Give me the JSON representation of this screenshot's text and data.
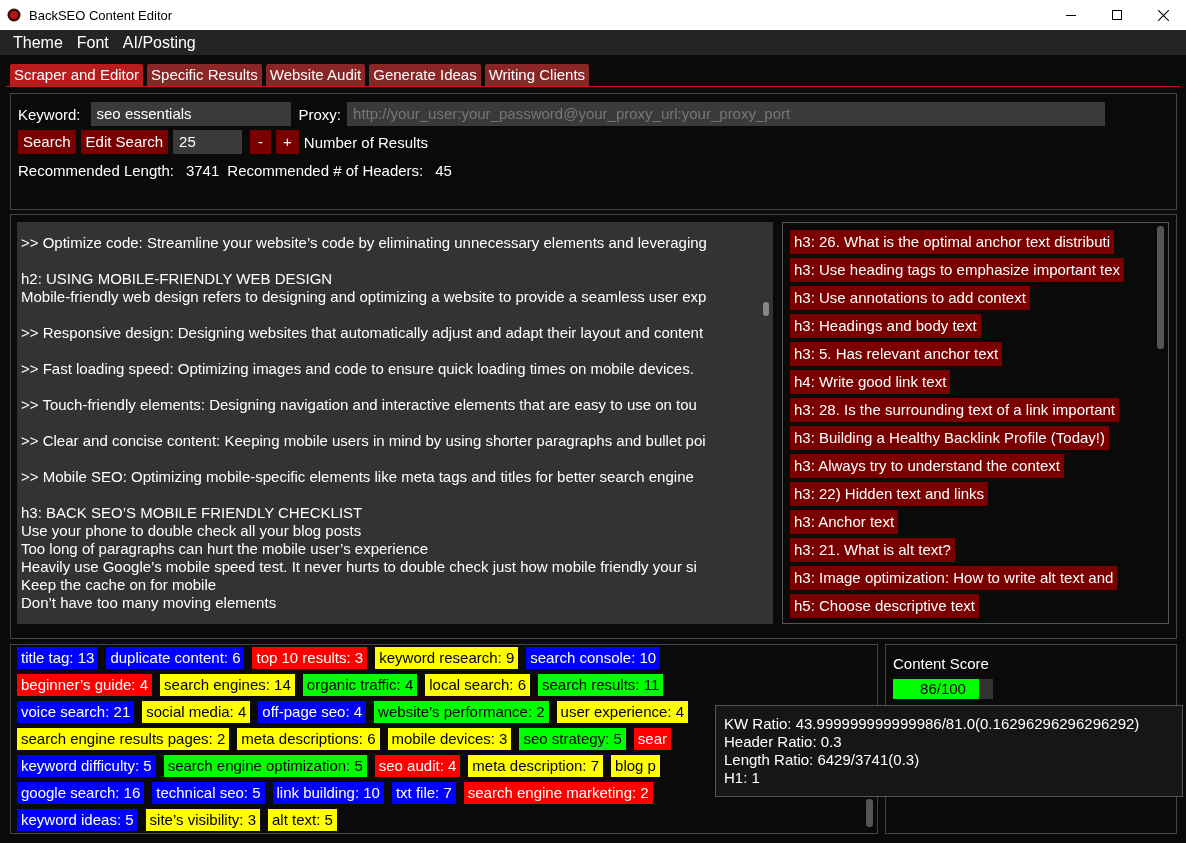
{
  "window": {
    "title": "BackSEO Content Editor"
  },
  "menu": [
    "Theme",
    "Font",
    "AI/Posting"
  ],
  "tabs": [
    {
      "label": "Scraper and Editor",
      "selected": true
    },
    {
      "label": "Specific Results",
      "selected": false
    },
    {
      "label": "Website Audit",
      "selected": false
    },
    {
      "label": "Generate Ideas",
      "selected": false
    },
    {
      "label": "Writing Clients",
      "selected": false
    }
  ],
  "search": {
    "keyword_label": "Keyword:",
    "keyword": "seo essentials",
    "proxy_label": "Proxy:",
    "proxy_placeholder": "http://your_user:your_password@your_proxy_url:your_proxy_port",
    "search_button": "Search",
    "edit_button": "Edit Search",
    "results": "25",
    "minus": "-",
    "plus": "+",
    "results_label": "Number of Results",
    "length_label": "Recommended Length:",
    "length": "3741",
    "headers_label": "Recommended # of Headers:",
    "headers": "45"
  },
  "editor": {
    "blocks": [
      [
        ">> Optimize code: Streamline your website’s code by eliminating unnecessary elements and leveraging"
      ],
      [
        "h2: USING MOBILE-FRIENDLY WEB DESIGN",
        "Mobile-friendly web design refers to designing and optimizing a website to provide a seamless user exp"
      ],
      [
        ">> Responsive design: Designing websites that automatically adjust and adapt their layout and content"
      ],
      [
        ">> Fast loading speed: Optimizing images and code to ensure quick loading times on mobile devices."
      ],
      [
        ">> Touch-friendly elements: Designing navigation and interactive elements that are easy to use on tou"
      ],
      [
        ">> Clear and concise content: Keeping mobile users in mind by using shorter paragraphs and bullet poi"
      ],
      [
        ">> Mobile SEO: Optimizing mobile-specific elements like meta tags and titles for better search engine"
      ],
      [
        "h3: BACK SEO’S MOBILE FRIENDLY CHECKLIST",
        "Use your phone to double check all your blog posts",
        "Too long of paragraphs can hurt the mobile user’s experience",
        "Heavily use Google’s mobile speed test. It never hurts to double check just how mobile friendly your si",
        "Keep the cache on for mobile",
        "Don’t have too many moving elements"
      ]
    ]
  },
  "headings": [
    "h3: 26. What is the optimal anchor text distributi",
    "h3: Use heading tags to emphasize important tex",
    "h3: Use annotations to add context",
    "h3: Headings and body text",
    "h3: 5. Has relevant anchor text",
    "h4: Write good link text",
    "h3: 28. Is the surrounding text of a link important",
    "h3: Building a Healthy Backlink Profile (Today!)",
    "h3: Always try to understand the context",
    "h3: 22) Hidden text and links",
    "h3: Anchor text",
    "h3: 21. What is alt text?",
    "h3: Image optimization: How to write alt text and",
    "h5: Choose descriptive text"
  ],
  "keywords": [
    [
      {
        "text": "title tag: 13",
        "color": "#0000ff"
      },
      {
        "text": "duplicate content: 6",
        "color": "#0000ff"
      },
      {
        "text": "top 10 results: 3",
        "color": "#ff0000"
      },
      {
        "text": "keyword research: 9",
        "color": "#ffff00"
      },
      {
        "text": "search console: 10",
        "color": "#0000ff"
      }
    ],
    [
      {
        "text": "beginner’s guide: 4",
        "color": "#ff0000"
      },
      {
        "text": "search engines: 14",
        "color": "#ffff00"
      },
      {
        "text": "organic traffic: 4",
        "color": "#00ff00"
      },
      {
        "text": "local search: 6",
        "color": "#ffff00"
      },
      {
        "text": "search results: 11",
        "color": "#00ff00"
      }
    ],
    [
      {
        "text": "voice search: 21",
        "color": "#0000ff"
      },
      {
        "text": "social media: 4",
        "color": "#ffff00"
      },
      {
        "text": "off-page seo: 4",
        "color": "#0000ff"
      },
      {
        "text": "website’s performance: 2",
        "color": "#00ff00"
      },
      {
        "text": "user experience: 4",
        "color": "#ffff00"
      }
    ],
    [
      {
        "text": "search engine results pages: 2",
        "color": "#ffff00"
      },
      {
        "text": "meta descriptions: 6",
        "color": "#ffff00"
      },
      {
        "text": "mobile devices: 3",
        "color": "#ffff00"
      },
      {
        "text": "seo strategy: 5",
        "color": "#00ff00"
      },
      {
        "text": "sear",
        "color": "#ff0000"
      }
    ],
    [
      {
        "text": "keyword difficulty: 5",
        "color": "#0000ff"
      },
      {
        "text": "search engine optimization: 5",
        "color": "#00ff00"
      },
      {
        "text": "seo audit: 4",
        "color": "#ff0000"
      },
      {
        "text": "meta description: 7",
        "color": "#ffff00"
      },
      {
        "text": "blog p",
        "color": "#ffff00"
      }
    ],
    [
      {
        "text": "google search: 16",
        "color": "#0000ff"
      },
      {
        "text": "technical seo: 5",
        "color": "#0000ff"
      },
      {
        "text": "link building: 10",
        "color": "#0000ff"
      },
      {
        "text": "txt file: 7",
        "color": "#0000ff"
      },
      {
        "text": "search engine marketing: 2",
        "color": "#ff0000"
      }
    ],
    [
      {
        "text": "keyword ideas: 5",
        "color": "#0000ff"
      },
      {
        "text": "site’s visibility: 3",
        "color": "#ffff00"
      },
      {
        "text": "alt text: 5",
        "color": "#ffff00"
      }
    ]
  ],
  "score": {
    "title": "Content Score",
    "level": 0.86,
    "reading": "86/100"
  },
  "tooltip": [
    "KW Ratio: 43.999999999999986/81.0(0.16296296296296292)",
    "Header Ratio: 0.3",
    "Length Ratio: 6429/3741(0.3)",
    "H1: 1"
  ]
}
